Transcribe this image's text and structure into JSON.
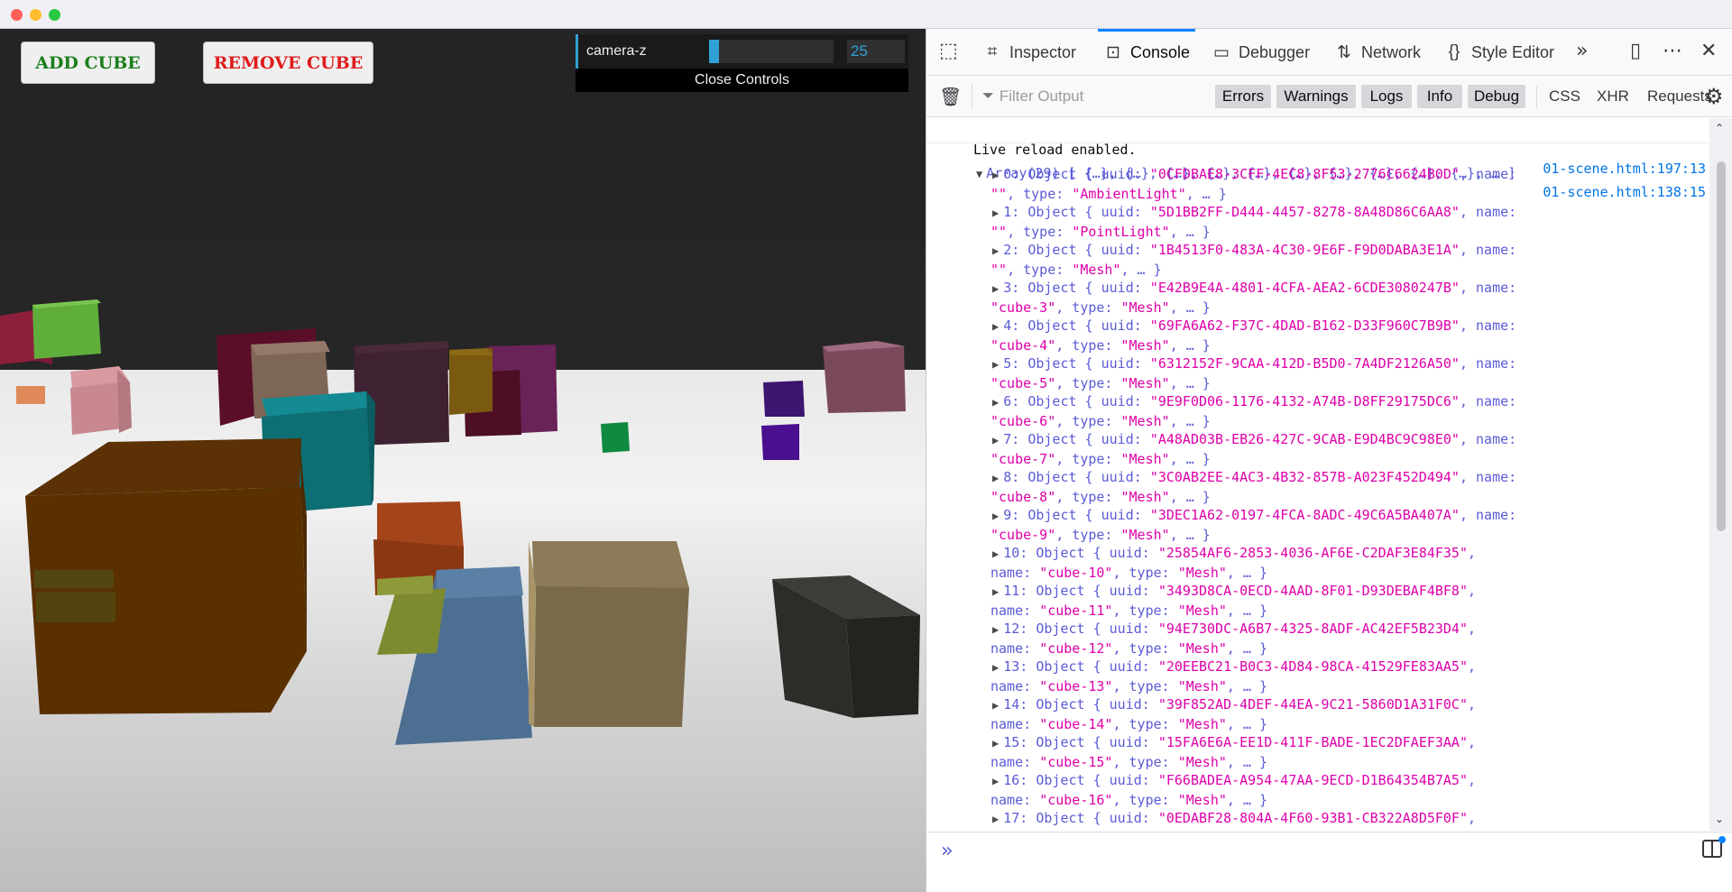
{
  "scene": {
    "add_cube_label": "ADD CUBE",
    "remove_cube_label": "REMOVE CUBE",
    "gui": {
      "control_label": "camera-z",
      "control_value": "25",
      "slider_fraction": 0.08,
      "close_label": "Close Controls"
    }
  },
  "devtools": {
    "tabs": [
      {
        "label": "Inspector",
        "icon": "inspector-icon"
      },
      {
        "label": "Console",
        "icon": "console-icon"
      },
      {
        "label": "Debugger",
        "icon": "debugger-icon"
      },
      {
        "label": "Network",
        "icon": "network-icon"
      },
      {
        "label": "Style Editor",
        "icon": "style-editor-icon"
      }
    ],
    "active_tab": "Console",
    "filter_placeholder": "Filter Output",
    "filters": [
      "Errors",
      "Warnings",
      "Logs",
      "Info",
      "Debug"
    ],
    "request_filters": [
      "CSS",
      "XHR",
      "Requests"
    ],
    "accent_color": "#0a84ff",
    "console": {
      "live_reload": {
        "text": "Live reload enabled.",
        "location": "01-scene.html:197:13"
      },
      "array_log": {
        "summary": "Array(29) [ {…}, {…}, {…}, {…}, {…}, {…}, {…}, {…}, {…}, {…}, … ]",
        "location": "01-scene.html:138:15",
        "items": [
          {
            "line1": "0: Object { uuid: \"0CFDBAE8-3CFF-4EC8-8F53-2776C6624B0D\", name:",
            "line2": "\"\", type: \"AmbientLight\", … }"
          },
          {
            "line1": "1: Object { uuid: \"5D1BB2FF-D444-4457-8278-8A48D86C6AA8\", name:",
            "line2": "\"\", type: \"PointLight\", … }"
          },
          {
            "line1": "2: Object { uuid: \"1B4513F0-483A-4C30-9E6F-F9D0DABA3E1A\", name:",
            "line2": "\"\", type: \"Mesh\", … }"
          },
          {
            "line1": "3: Object { uuid: \"E42B9E4A-4801-4CFA-AEA2-6CDE3080247B\", name:",
            "line2": "\"cube-3\", type: \"Mesh\", … }"
          },
          {
            "line1": "4: Object { uuid: \"69FA6A62-F37C-4DAD-B162-D33F960C7B9B\", name:",
            "line2": "\"cube-4\", type: \"Mesh\", … }"
          },
          {
            "line1": "5: Object { uuid: \"6312152F-9CAA-412D-B5D0-7A4DF2126A50\", name:",
            "line2": "\"cube-5\", type: \"Mesh\", … }"
          },
          {
            "line1": "6: Object { uuid: \"9E9F0D06-1176-4132-A74B-D8FF29175DC6\", name:",
            "line2": "\"cube-6\", type: \"Mesh\", … }"
          },
          {
            "line1": "7: Object { uuid: \"A48AD03B-EB26-427C-9CAB-E9D4BC9C98E0\", name:",
            "line2": "\"cube-7\", type: \"Mesh\", … }"
          },
          {
            "line1": "8: Object { uuid: \"3C0AB2EE-4AC3-4B32-857B-A023F452D494\", name:",
            "line2": "\"cube-8\", type: \"Mesh\", … }"
          },
          {
            "line1": "9: Object { uuid: \"3DEC1A62-0197-4FCA-8ADC-49C6A5BA407A\", name:",
            "line2": "\"cube-9\", type: \"Mesh\", … }"
          },
          {
            "line1": "10: Object { uuid: \"25854AF6-2853-4036-AF6E-C2DAF3E84F35\",",
            "line2": "name: \"cube-10\", type: \"Mesh\", … }"
          },
          {
            "line1": "11: Object { uuid: \"3493D8CA-0ECD-4AAD-8F01-D93DEBAF4BF8\",",
            "line2": "name: \"cube-11\", type: \"Mesh\", … }"
          },
          {
            "line1": "12: Object { uuid: \"94E730DC-A6B7-4325-8ADF-AC42EF5B23D4\",",
            "line2": "name: \"cube-12\", type: \"Mesh\", … }"
          },
          {
            "line1": "13: Object { uuid: \"20EEBC21-B0C3-4D84-98CA-41529FE83AA5\",",
            "line2": "name: \"cube-13\", type: \"Mesh\", … }"
          },
          {
            "line1": "14: Object { uuid: \"39F852AD-4DEF-44EA-9C21-5860D1A31F0C\",",
            "line2": "name: \"cube-14\", type: \"Mesh\", … }"
          },
          {
            "line1": "15: Object { uuid: \"15FA6E6A-EE1D-411F-BADE-1EC2DFAEF3AA\",",
            "line2": "name: \"cube-15\", type: \"Mesh\", … }"
          },
          {
            "line1": "16: Object { uuid: \"F66BADEA-A954-47AA-9ECD-D1B64354B7A5\",",
            "line2": "name: \"cube-16\", type: \"Mesh\", … }"
          },
          {
            "line1": "17: Object { uuid: \"0EDABF28-804A-4F60-93B1-CB322A8D5F0F\",",
            "line2": ""
          }
        ]
      }
    }
  }
}
